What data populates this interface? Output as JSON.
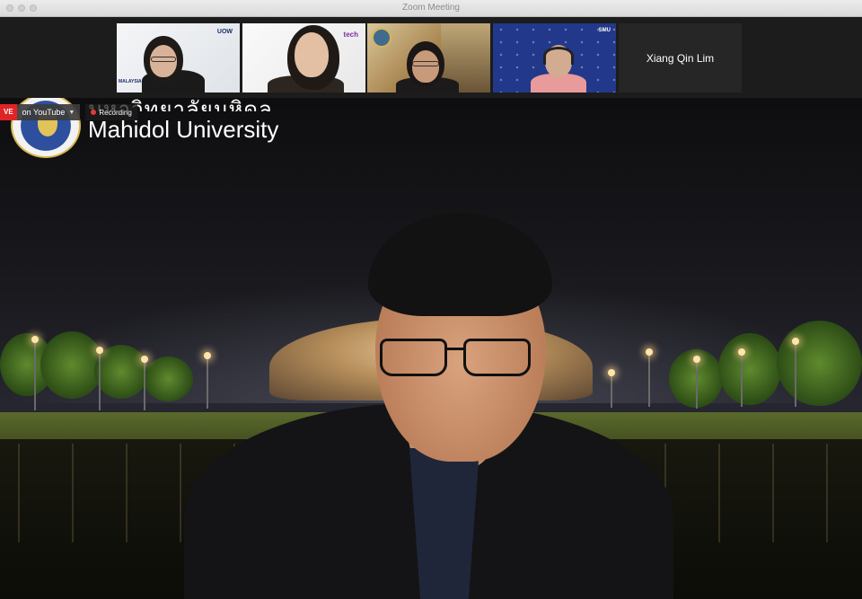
{
  "window": {
    "title": "Zoom Meeting"
  },
  "gallery": {
    "participants": [
      {
        "name": "",
        "logo_text": "UOW",
        "logo_subtext": "MALAYSIA"
      },
      {
        "name": "",
        "logo_text": "tech"
      },
      {
        "name": "",
        "logo_text": ""
      },
      {
        "name": "",
        "logo_text": "SMU"
      },
      {
        "name": "Xiang Qin Lim"
      }
    ]
  },
  "status": {
    "live_label": "VE",
    "stream_label": "on YouTube",
    "recording_label": "Recording"
  },
  "main": {
    "background_title_thai": "มหาวิทยาลัยมหิดล",
    "background_title": "Mahidol University"
  },
  "colors": {
    "live": "#e02424",
    "recording_dot": "#e53935",
    "gallery_bg": "#1c1c1c",
    "titlebar": "#e0e0e0"
  }
}
